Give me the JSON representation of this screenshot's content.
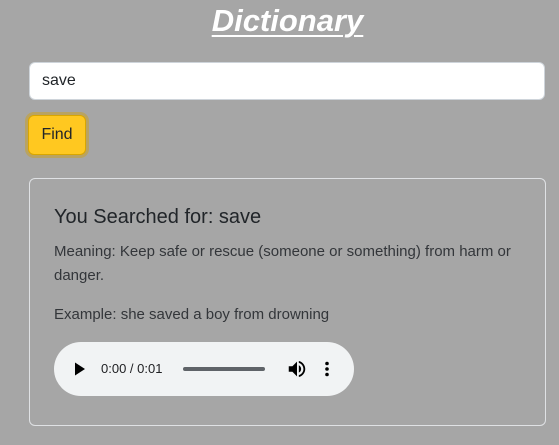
{
  "app": {
    "title": "Dictionary"
  },
  "search": {
    "value": "save"
  },
  "actions": {
    "find_label": "Find"
  },
  "result": {
    "heading": "You Searched for: save",
    "meaning": "Meaning: Keep safe or rescue (someone or something) from harm or danger.",
    "example": "Example: she saved a boy from drowning"
  },
  "audio": {
    "time": "0:00 / 0:01",
    "play_icon": "play-icon",
    "volume_icon": "volume-icon",
    "more_icon": "more-vertical-icon"
  },
  "colors": {
    "background": "#a6a6a6",
    "accent": "#ffc820"
  }
}
